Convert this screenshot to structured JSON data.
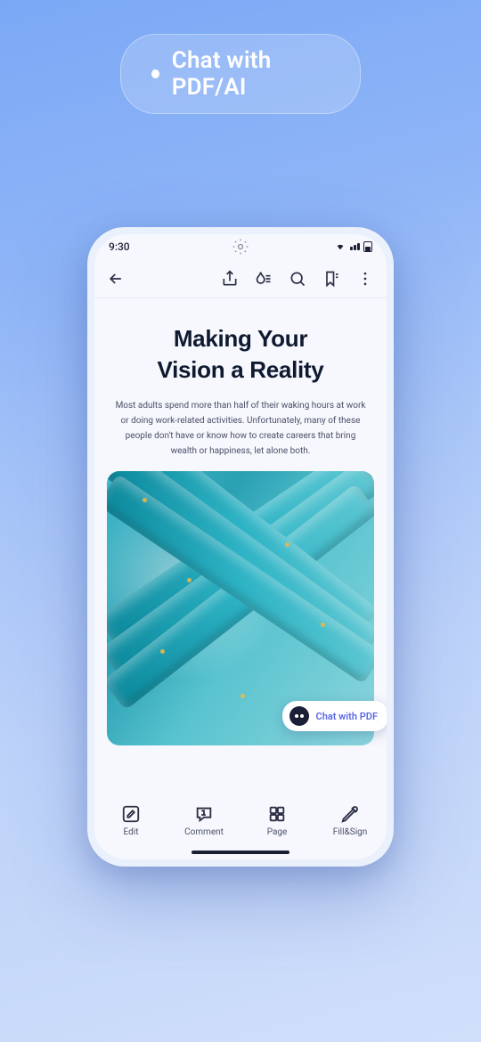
{
  "badge": {
    "label": "Chat with PDF/AI"
  },
  "status": {
    "time": "9:30"
  },
  "doc": {
    "title_line1": "Making Your",
    "title_line2": "Vision a Reality",
    "body": "Most adults spend more than half of their waking hours at work or doing work-related activities. Unfortunately, many of these people don't have or know how to create careers that bring wealth or happiness, let alone both."
  },
  "chat": {
    "label": "Chat with PDF"
  },
  "tabs": {
    "edit": "Edit",
    "comment": "Comment",
    "page": "Page",
    "fillsign": "Fill&Sign"
  }
}
